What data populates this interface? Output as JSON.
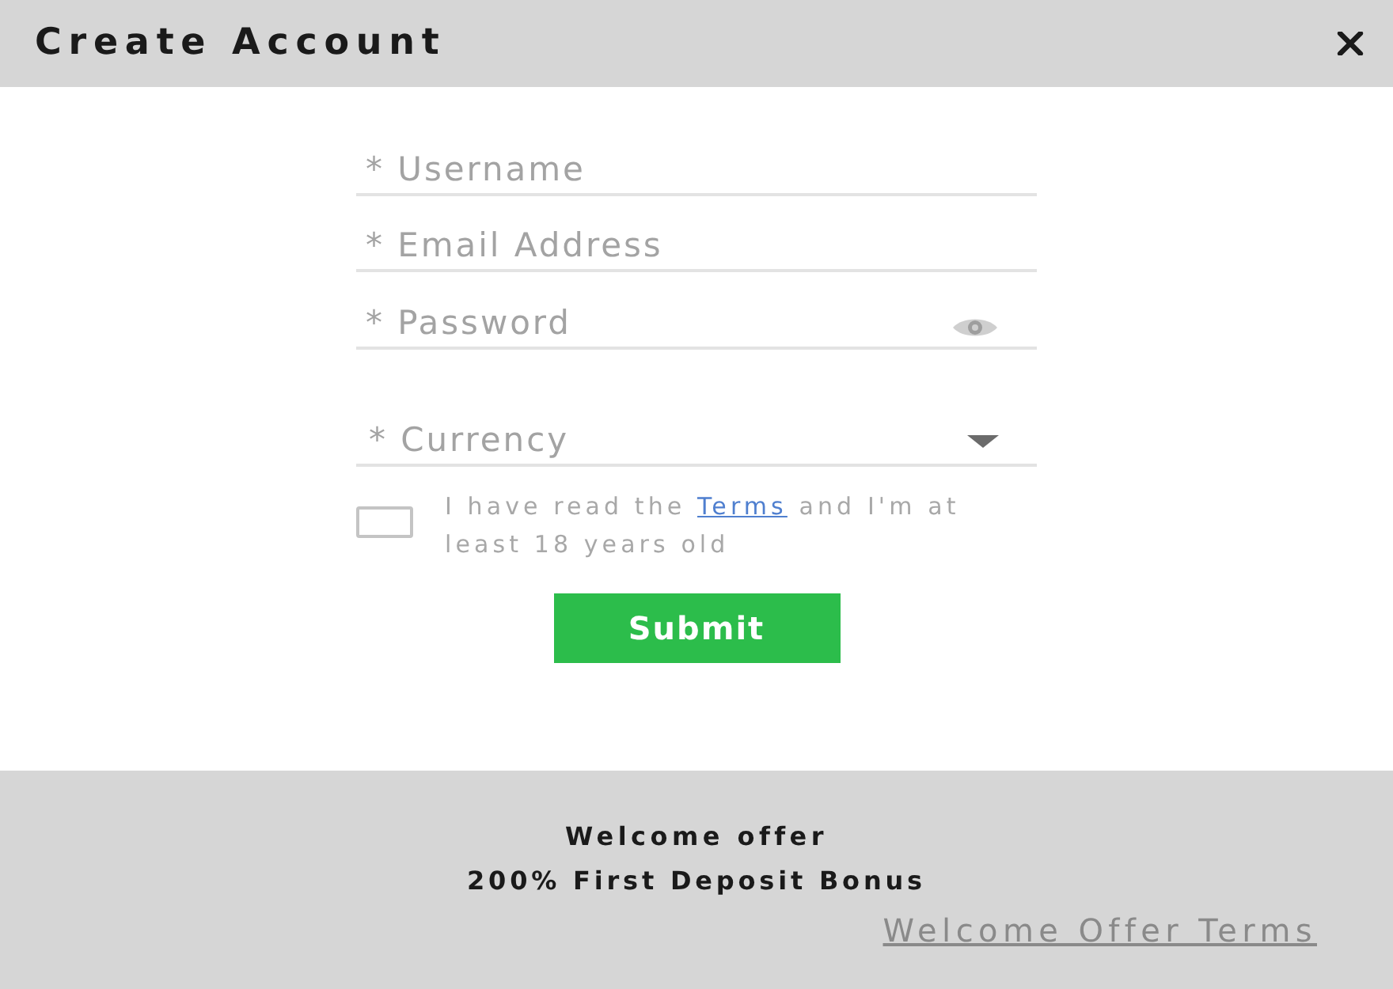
{
  "dialog": {
    "title": "Create Account"
  },
  "form": {
    "fields": [
      {
        "kind": "text",
        "placeholder": "* Username"
      },
      {
        "kind": "email",
        "placeholder": "* Email Address"
      },
      {
        "kind": "password",
        "placeholder": "* Password"
      },
      {
        "kind": "select",
        "placeholder": "* Currency"
      }
    ],
    "agreement": {
      "checked": false,
      "text_before": "I have read the ",
      "link": "Terms",
      "text_after": " and I'm at least 18 years old"
    },
    "submit": "Submit"
  },
  "footer": {
    "offer_title": "Welcome offer",
    "offer": "200% First Deposit Bonus",
    "terms_link": "Welcome Offer Terms"
  }
}
